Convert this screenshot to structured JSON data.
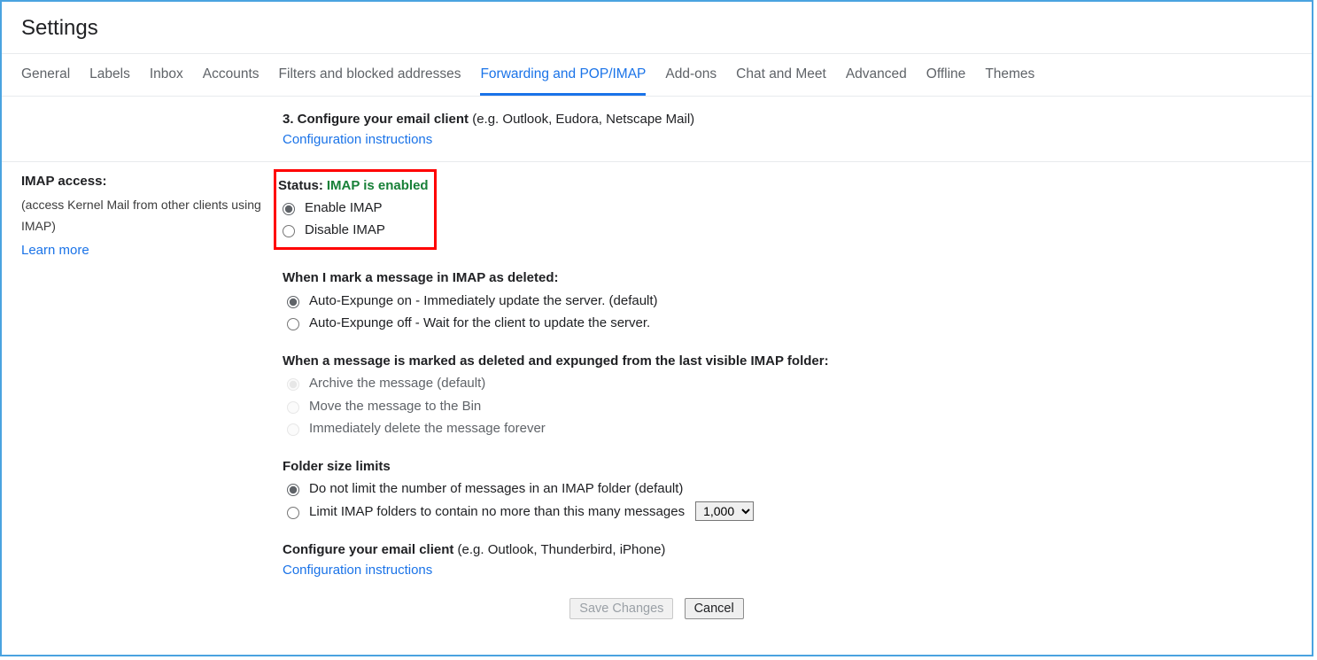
{
  "title": "Settings",
  "tabs": [
    "General",
    "Labels",
    "Inbox",
    "Accounts",
    "Filters and blocked addresses",
    "Forwarding and POP/IMAP",
    "Add-ons",
    "Chat and Meet",
    "Advanced",
    "Offline",
    "Themes"
  ],
  "activeTab": 5,
  "top": {
    "stepBold": "3. Configure your email client",
    "stepRest": " (e.g. Outlook, Eudora, Netscape Mail)",
    "configLink": "Configuration instructions"
  },
  "left": {
    "title": "IMAP access:",
    "desc": "(access Kernel Mail from other clients using IMAP)",
    "learn": "Learn more"
  },
  "imap": {
    "statusLabel": "Status:",
    "statusValue": "IMAP is enabled",
    "enable": "Enable IMAP",
    "disable": "Disable IMAP"
  },
  "deletedGroup": {
    "title": "When I mark a message in IMAP as deleted:",
    "opt1": "Auto-Expunge on - Immediately update the server. (default)",
    "opt2": "Auto-Expunge off - Wait for the client to update the server."
  },
  "expungedGroup": {
    "title": "When a message is marked as deleted and expunged from the last visible IMAP folder:",
    "opt1": "Archive the message (default)",
    "opt2": "Move the message to the Bin",
    "opt3": "Immediately delete the message forever"
  },
  "folderGroup": {
    "title": "Folder size limits",
    "opt1": "Do not limit the number of messages in an IMAP folder (default)",
    "opt2": "Limit IMAP folders to contain no more than this many messages",
    "selectValue": "1,000"
  },
  "config": {
    "bold": "Configure your email client",
    "rest": " (e.g. Outlook, Thunderbird, iPhone)",
    "link": "Configuration instructions"
  },
  "buttons": {
    "save": "Save Changes",
    "cancel": "Cancel"
  }
}
